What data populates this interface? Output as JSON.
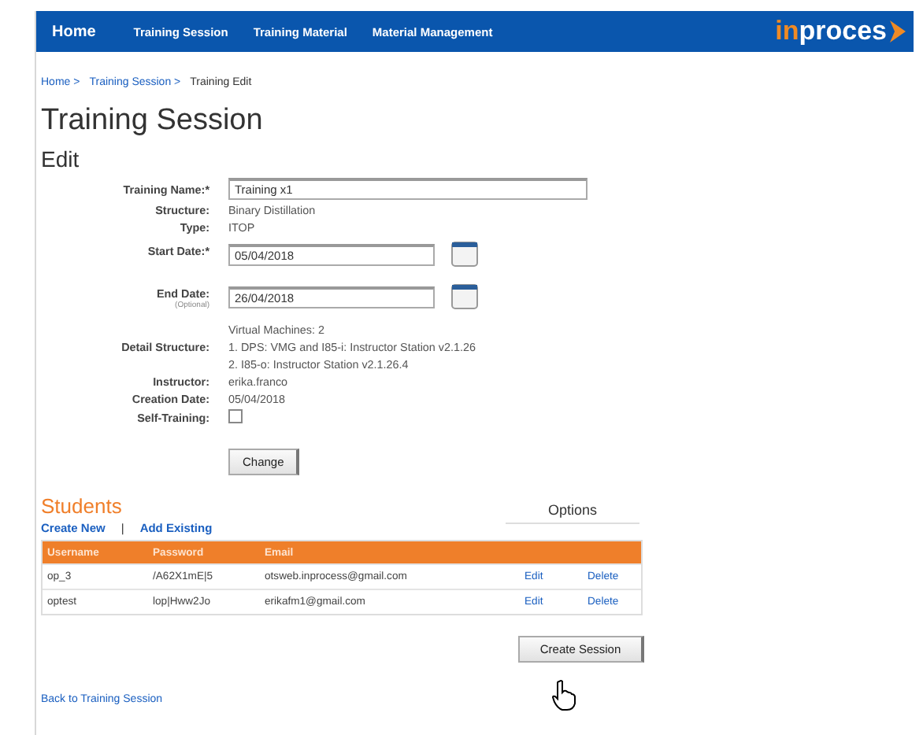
{
  "nav": {
    "items": [
      {
        "label": "Home",
        "selected": true
      },
      {
        "label": "Training Session",
        "selected": false
      },
      {
        "label": "Training Material",
        "selected": false
      },
      {
        "label": "Material Management",
        "selected": false
      }
    ],
    "logo": {
      "accent": "in",
      "rest": "proces"
    }
  },
  "breadcrumb": [
    {
      "label": "Home >",
      "link": true
    },
    {
      "label": "Training Session >",
      "link": true
    },
    {
      "label": "Training Edit",
      "link": false
    }
  ],
  "title": "Training Session",
  "subtitle": "Edit",
  "form": [
    {
      "kind": "input",
      "label": "Training Name:*",
      "value": "Training x1"
    },
    {
      "kind": "text",
      "label": "Structure:",
      "lines": [
        "Binary Distillation"
      ]
    },
    {
      "kind": "text",
      "label": "Type:",
      "lines": [
        "ITOP"
      ]
    },
    {
      "kind": "date",
      "label": "Start Date:*",
      "value": "05/04/2018"
    },
    {
      "kind": "date",
      "label": "End Date:",
      "note": "(Optional)",
      "value": "26/04/2018"
    },
    {
      "kind": "text",
      "label": "Detail Structure:",
      "lines": [
        "Virtual Machines: 2",
        "1. DPS: VMG and I85-i: Instructor Station v2.1.26",
        "2. I85-o: Instructor Station v2.1.26.4"
      ]
    },
    {
      "kind": "text",
      "label": "Instructor:",
      "lines": [
        "erika.franco"
      ]
    },
    {
      "kind": "text",
      "label": "Creation Date:",
      "lines": [
        "05/04/2018"
      ]
    },
    {
      "kind": "checkbox",
      "label": "Self-Training:",
      "checked": false
    }
  ],
  "change_button": "Change",
  "students": {
    "heading": "Students",
    "options_heading": "Options",
    "actions": [
      "Create New",
      "|",
      "Add Existing"
    ],
    "columns": [
      "Username",
      "Password",
      "Email"
    ],
    "rows": [
      {
        "username": "op_3",
        "password": "/A62X1mE|5",
        "email": "otsweb.inprocess@gmail.com",
        "edit": "Edit",
        "delete": "Delete"
      },
      {
        "username": "optest",
        "password": "lop|Hww2Jo",
        "email": "erikafm1@gmail.com",
        "edit": "Edit",
        "delete": "Delete"
      }
    ]
  },
  "create_button": "Create Session",
  "back_link": "Back to Training Session"
}
